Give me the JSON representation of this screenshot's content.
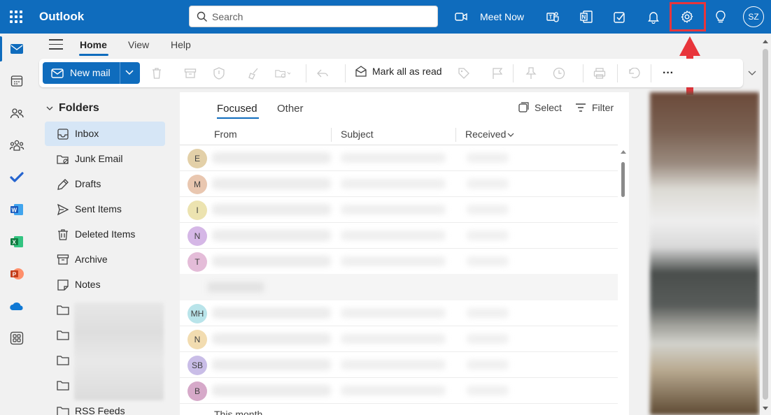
{
  "app": {
    "name": "Outlook"
  },
  "colors": {
    "brand": "#0f6cbd",
    "highlight": "#e8353b",
    "selected_folder": "#d6e6f6"
  },
  "search": {
    "placeholder": "Search"
  },
  "topbar": {
    "meet_now_label": "Meet Now",
    "icons": [
      "video-icon",
      "teams-icon",
      "onenote-icon",
      "todo-icon",
      "bell-icon",
      "gear-icon",
      "lightbulb-icon"
    ],
    "user_initials": "SZ"
  },
  "rail": {
    "items": [
      "mail-icon",
      "calendar-icon",
      "people-icon",
      "groups-icon",
      "todo-check-icon",
      "word-icon",
      "excel-icon",
      "powerpoint-icon",
      "onedrive-icon",
      "apps-icon"
    ],
    "selected": "mail-icon"
  },
  "tabs": [
    {
      "label": "Home",
      "active": true
    },
    {
      "label": "View",
      "active": false
    },
    {
      "label": "Help",
      "active": false
    }
  ],
  "ribbon": {
    "new_mail_label": "New mail",
    "mark_all_read_label": "Mark all as read",
    "more_label": "···"
  },
  "folders": {
    "header": "Folders",
    "items": [
      {
        "name": "Inbox",
        "icon": "inbox-icon",
        "selected": true
      },
      {
        "name": "Junk Email",
        "icon": "junk-icon",
        "selected": false
      },
      {
        "name": "Drafts",
        "icon": "drafts-icon",
        "selected": false
      },
      {
        "name": "Sent Items",
        "icon": "send-icon",
        "selected": false
      },
      {
        "name": "Deleted Items",
        "icon": "trash-icon",
        "selected": false
      },
      {
        "name": "Archive",
        "icon": "archive-icon",
        "selected": false
      },
      {
        "name": "Notes",
        "icon": "notes-icon",
        "selected": false
      },
      {
        "name": "RSS Feeds",
        "icon": "folder-icon",
        "selected": false
      }
    ]
  },
  "message_list": {
    "tabs": [
      {
        "label": "Focused",
        "active": true
      },
      {
        "label": "Other",
        "active": false
      }
    ],
    "select_label": "Select",
    "filter_label": "Filter",
    "columns": {
      "from": "From",
      "subject": "Subject",
      "received": "Received"
    },
    "rows": [
      {
        "initials": "E",
        "avatar_color": "#e3d0a8"
      },
      {
        "initials": "M",
        "avatar_color": "#e9c7b0"
      },
      {
        "initials": "I",
        "avatar_color": "#ece3b0"
      },
      {
        "initials": "N",
        "avatar_color": "#d5b7e6"
      },
      {
        "initials": "T",
        "avatar_color": "#e4bcd8"
      },
      {
        "initials": "MH",
        "avatar_color": "#b9e4ea"
      },
      {
        "initials": "N",
        "avatar_color": "#f2dcb0"
      },
      {
        "initials": "SB",
        "avatar_color": "#c9bde7"
      },
      {
        "initials": "B",
        "avatar_color": "#d6a9c9"
      }
    ],
    "group_footer": "This month"
  }
}
